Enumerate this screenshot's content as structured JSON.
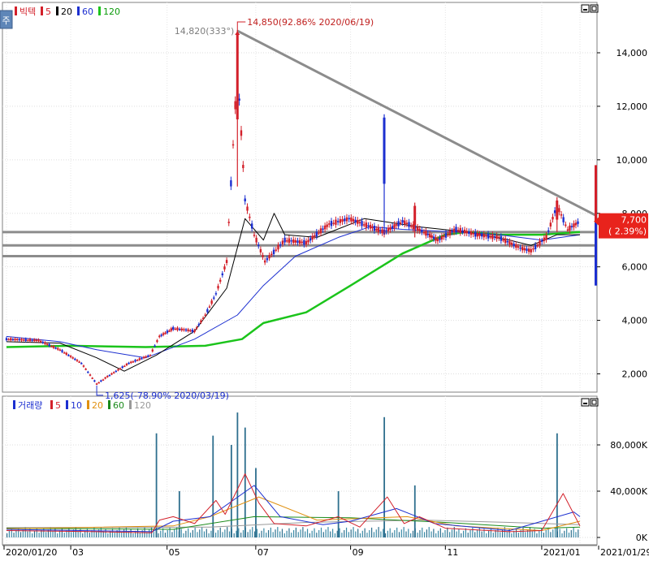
{
  "chart_data": [
    {
      "type": "candlestick",
      "legend": [
        {
          "text": "빅텍",
          "color": "#d3202a"
        },
        {
          "text": "5",
          "color": "#d3202a"
        },
        {
          "text": "20",
          "color": "#000000"
        },
        {
          "text": "60",
          "color": "#1c2fd0"
        },
        {
          "text": "120",
          "color": "#1bc41b"
        }
      ],
      "ylim": [
        1000,
        15500
      ],
      "y_ticks": [
        2000,
        4000,
        6000,
        8000,
        10000,
        12000,
        14000
      ],
      "y_tick_labels": [
        "2,000",
        "4,000",
        "6,000",
        "8,000",
        "10,000",
        "12,000",
        "14,000"
      ],
      "x_start": "2020/01/20",
      "x_end": "2021/01/29",
      "x_ticks": [
        {
          "date": "2020/01/20",
          "label": "2020/01/20"
        },
        {
          "date": "2020/03/02",
          "label": "03"
        },
        {
          "date": "2020/05/04",
          "label": "05"
        },
        {
          "date": "2020/07/01",
          "label": "07"
        },
        {
          "date": "2020/09/01",
          "label": "09"
        },
        {
          "date": "2020/11/02",
          "label": "11"
        },
        {
          "date": "2021/01/04",
          "label": "2021/01"
        },
        {
          "date": "2021/01/29",
          "label": "2021/01/29"
        }
      ],
      "price_line": [
        {
          "date": "2020/01/20",
          "value": 3300
        },
        {
          "date": "2020/02/10",
          "value": 3250
        },
        {
          "date": "2020/02/24",
          "value": 2900
        },
        {
          "date": "2020/03/09",
          "value": 2400
        },
        {
          "date": "2020/03/19",
          "value": 1625
        },
        {
          "date": "2020/03/26",
          "value": 1900
        },
        {
          "date": "2020/04/09",
          "value": 2400
        },
        {
          "date": "2020/04/23",
          "value": 2700
        },
        {
          "date": "2020/04/29",
          "value": 3400
        },
        {
          "date": "2020/05/08",
          "value": 3700
        },
        {
          "date": "2020/05/22",
          "value": 3600
        },
        {
          "date": "2020/05/29",
          "value": 4200
        },
        {
          "date": "2020/06/05",
          "value": 5000
        },
        {
          "date": "2020/06/12",
          "value": 6200
        },
        {
          "date": "2020/06/19",
          "value": 13500
        },
        {
          "date": "2020/06/24",
          "value": 8500
        },
        {
          "date": "2020/06/30",
          "value": 7200
        },
        {
          "date": "2020/07/07",
          "value": 6200
        },
        {
          "date": "2020/07/20",
          "value": 7000
        },
        {
          "date": "2020/08/03",
          "value": 6900
        },
        {
          "date": "2020/08/18",
          "value": 7600
        },
        {
          "date": "2020/08/31",
          "value": 7800
        },
        {
          "date": "2020/09/14",
          "value": 7500
        },
        {
          "date": "2020/09/23",
          "value": 7300
        },
        {
          "date": "2020/10/05",
          "value": 7700
        },
        {
          "date": "2020/10/19",
          "value": 7300
        },
        {
          "date": "2020/10/28",
          "value": 7000
        },
        {
          "date": "2020/11/09",
          "value": 7400
        },
        {
          "date": "2020/11/23",
          "value": 7200
        },
        {
          "date": "2020/12/07",
          "value": 7100
        },
        {
          "date": "2020/12/21",
          "value": 6700
        },
        {
          "date": "2020/12/28",
          "value": 6600
        },
        {
          "date": "2021/01/07",
          "value": 7100
        },
        {
          "date": "2021/01/14",
          "value": 8300
        },
        {
          "date": "2021/01/21",
          "value": 7400
        },
        {
          "date": "2021/01/29",
          "value": 7700
        }
      ],
      "ma20": [
        {
          "date": "2020/01/20",
          "value": 3200
        },
        {
          "date": "2020/02/24",
          "value": 3150
        },
        {
          "date": "2020/03/19",
          "value": 2600
        },
        {
          "date": "2020/04/06",
          "value": 2100
        },
        {
          "date": "2020/04/27",
          "value": 2700
        },
        {
          "date": "2020/05/22",
          "value": 3600
        },
        {
          "date": "2020/06/12",
          "value": 5200
        },
        {
          "date": "2020/06/24",
          "value": 7800
        },
        {
          "date": "2020/07/06",
          "value": 7000
        },
        {
          "date": "2020/07/13",
          "value": 8000
        },
        {
          "date": "2020/07/20",
          "value": 7200
        },
        {
          "date": "2020/08/10",
          "value": 7100
        },
        {
          "date": "2020/09/10",
          "value": 7800
        },
        {
          "date": "2020/10/15",
          "value": 7500
        },
        {
          "date": "2020/11/16",
          "value": 7300
        },
        {
          "date": "2020/12/14",
          "value": 7000
        },
        {
          "date": "2020/12/28",
          "value": 6800
        },
        {
          "date": "2021/01/14",
          "value": 7200
        },
        {
          "date": "2021/01/29",
          "value": 7200
        }
      ],
      "ma60": [
        {
          "date": "2020/01/20",
          "value": 3400
        },
        {
          "date": "2020/02/24",
          "value": 3200
        },
        {
          "date": "2020/03/19",
          "value": 2900
        },
        {
          "date": "2020/04/20",
          "value": 2600
        },
        {
          "date": "2020/05/22",
          "value": 3300
        },
        {
          "date": "2020/06/19",
          "value": 4200
        },
        {
          "date": "2020/07/06",
          "value": 5300
        },
        {
          "date": "2020/07/27",
          "value": 6400
        },
        {
          "date": "2020/08/24",
          "value": 7100
        },
        {
          "date": "2020/09/14",
          "value": 7500
        },
        {
          "date": "2020/10/05",
          "value": 7400
        },
        {
          "date": "2020/11/09",
          "value": 7300
        },
        {
          "date": "2020/12/07",
          "value": 7200
        },
        {
          "date": "2021/01/04",
          "value": 7000
        },
        {
          "date": "2021/01/29",
          "value": 7200
        }
      ],
      "ma120": [
        {
          "date": "2020/01/20",
          "value": 3000
        },
        {
          "date": "2020/03/02",
          "value": 3050
        },
        {
          "date": "2020/04/20",
          "value": 3000
        },
        {
          "date": "2020/05/29",
          "value": 3050
        },
        {
          "date": "2020/06/22",
          "value": 3300
        },
        {
          "date": "2020/07/06",
          "value": 3900
        },
        {
          "date": "2020/08/03",
          "value": 4300
        },
        {
          "date": "2020/09/01",
          "value": 5300
        },
        {
          "date": "2020/10/05",
          "value": 6500
        },
        {
          "date": "2020/11/02",
          "value": 7200
        },
        {
          "date": "2020/11/16",
          "value": 7300
        },
        {
          "date": "2020/12/07",
          "value": 7200
        },
        {
          "date": "2021/01/04",
          "value": 7200
        },
        {
          "date": "2021/01/29",
          "value": 7300
        }
      ],
      "spikes": [
        {
          "date": "2020/06/19",
          "low": 9000,
          "high": 14850
        },
        {
          "date": "2020/09/23",
          "low": 7200,
          "high": 11700
        },
        {
          "date": "2020/10/13",
          "low": 7100,
          "high": 8400
        },
        {
          "date": "2021/01/14",
          "low": 7300,
          "high": 8600
        }
      ],
      "trend_line": {
        "from": {
          "date": "2020/06/19",
          "value": 14820
        },
        "to": {
          "date": "2021/01/29",
          "value": 7900
        }
      },
      "horizontal_lines": [
        7300,
        6800,
        6400
      ],
      "annotations": {
        "high": {
          "text": "14,850(92.86% 2020/06/19)",
          "date": "2020/06/19",
          "value": 14850
        },
        "trend_start": {
          "text": "14,820(333°)"
        },
        "low": {
          "text": "1,625(-78.90% 2020/03/19)",
          "date": "2020/03/19",
          "value": 1625
        }
      },
      "current_price": {
        "value": 7700,
        "label": "7,700",
        "change": "( 2.39%)"
      },
      "right_marker": {
        "high": 9800,
        "low": 5300
      }
    },
    {
      "type": "bar",
      "legend": [
        {
          "text": "거래량",
          "color": "#1c2fd0"
        },
        {
          "text": "5",
          "color": "#d3202a"
        },
        {
          "text": "10",
          "color": "#1c2fd0"
        },
        {
          "text": "20",
          "color": "#e09010"
        },
        {
          "text": "60",
          "color": "#1a8a1a"
        },
        {
          "text": "120",
          "color": "#999999"
        }
      ],
      "ylim": [
        0,
        120000
      ],
      "y_ticks": [
        0,
        40000,
        80000
      ],
      "y_tick_labels": [
        "0K",
        "40,000K",
        "80,000K"
      ],
      "volume_spikes": [
        {
          "date": "2020/04/27",
          "value": 90000
        },
        {
          "date": "2020/05/12",
          "value": 40000
        },
        {
          "date": "2020/06/03",
          "value": 88000
        },
        {
          "date": "2020/06/15",
          "value": 80000
        },
        {
          "date": "2020/06/19",
          "value": 108000
        },
        {
          "date": "2020/06/24",
          "value": 95000
        },
        {
          "date": "2020/07/01",
          "value": 60000
        },
        {
          "date": "2020/08/24",
          "value": 40000
        },
        {
          "date": "2020/09/23",
          "value": 104000
        },
        {
          "date": "2020/10/13",
          "value": 45000
        },
        {
          "date": "2021/01/14",
          "value": 90000
        }
      ],
      "baseline_volume": 6000,
      "vma5": [
        {
          "date": "2020/01/20",
          "value": 6000
        },
        {
          "date": "2020/03/19",
          "value": 5000
        },
        {
          "date": "2020/04/24",
          "value": 4000
        },
        {
          "date": "2020/04/29",
          "value": 15000
        },
        {
          "date": "2020/05/08",
          "value": 18000
        },
        {
          "date": "2020/05/22",
          "value": 12000
        },
        {
          "date": "2020/06/05",
          "value": 32000
        },
        {
          "date": "2020/06/11",
          "value": 20000
        },
        {
          "date": "2020/06/24",
          "value": 55000
        },
        {
          "date": "2020/07/03",
          "value": 30000
        },
        {
          "date": "2020/07/13",
          "value": 12000
        },
        {
          "date": "2020/08/03",
          "value": 10000
        },
        {
          "date": "2020/08/24",
          "value": 18000
        },
        {
          "date": "2020/09/07",
          "value": 9000
        },
        {
          "date": "2020/09/25",
          "value": 35000
        },
        {
          "date": "2020/10/06",
          "value": 12000
        },
        {
          "date": "2020/10/16",
          "value": 18000
        },
        {
          "date": "2020/11/02",
          "value": 8000
        },
        {
          "date": "2020/12/14",
          "value": 5000
        },
        {
          "date": "2021/01/04",
          "value": 6000
        },
        {
          "date": "2021/01/18",
          "value": 38000
        },
        {
          "date": "2021/01/29",
          "value": 10000
        }
      ],
      "vma10": [
        {
          "date": "2020/01/20",
          "value": 7000
        },
        {
          "date": "2020/04/24",
          "value": 5000
        },
        {
          "date": "2020/05/08",
          "value": 14000
        },
        {
          "date": "2020/06/01",
          "value": 18000
        },
        {
          "date": "2020/06/30",
          "value": 45000
        },
        {
          "date": "2020/07/17",
          "value": 18000
        },
        {
          "date": "2020/08/14",
          "value": 11000
        },
        {
          "date": "2020/09/01",
          "value": 14000
        },
        {
          "date": "2020/10/01",
          "value": 25000
        },
        {
          "date": "2020/10/26",
          "value": 12000
        },
        {
          "date": "2020/12/14",
          "value": 6000
        },
        {
          "date": "2021/01/25",
          "value": 22000
        },
        {
          "date": "2021/01/29",
          "value": 18000
        }
      ],
      "vma20": [
        {
          "date": "2020/01/20",
          "value": 7500
        },
        {
          "date": "2020/05/08",
          "value": 10000
        },
        {
          "date": "2020/06/01",
          "value": 18000
        },
        {
          "date": "2020/07/03",
          "value": 35000
        },
        {
          "date": "2020/08/10",
          "value": 15000
        },
        {
          "date": "2020/10/08",
          "value": 18000
        },
        {
          "date": "2020/11/09",
          "value": 10000
        },
        {
          "date": "2021/01/04",
          "value": 6000
        },
        {
          "date": "2021/01/29",
          "value": 14000
        }
      ],
      "vma60": [
        {
          "date": "2020/01/20",
          "value": 8000
        },
        {
          "date": "2020/05/08",
          "value": 7000
        },
        {
          "date": "2020/06/30",
          "value": 18000
        },
        {
          "date": "2020/09/01",
          "value": 17000
        },
        {
          "date": "2020/11/02",
          "value": 13000
        },
        {
          "date": "2021/01/04",
          "value": 8000
        },
        {
          "date": "2021/01/29",
          "value": 9000
        }
      ],
      "vma120": [
        {
          "date": "2020/01/20",
          "value": 8500
        },
        {
          "date": "2020/06/01",
          "value": 9000
        },
        {
          "date": "2020/08/03",
          "value": 13000
        },
        {
          "date": "2020/10/19",
          "value": 15000
        },
        {
          "date": "2020/12/14",
          "value": 13000
        },
        {
          "date": "2021/01/29",
          "value": 11000
        }
      ]
    }
  ],
  "toolbar": {
    "menu_glyph": "주"
  }
}
